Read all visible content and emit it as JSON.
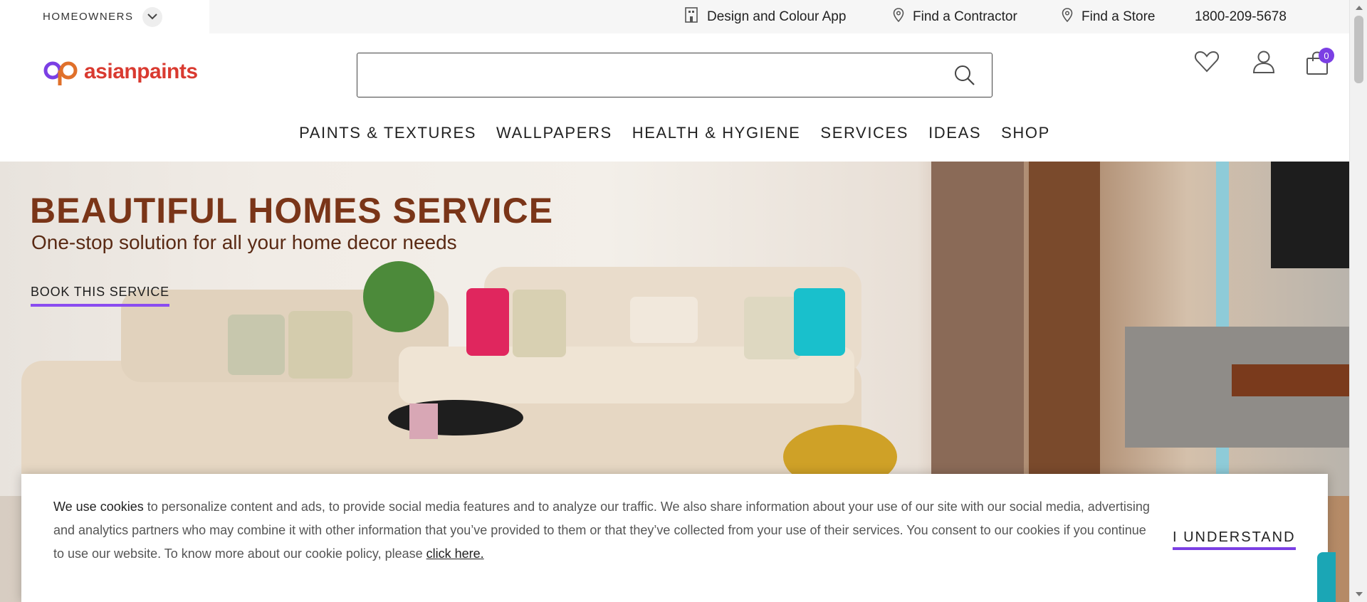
{
  "topbar": {
    "segment": "HOMEOWNERS",
    "links": [
      {
        "label": "Design and Colour App",
        "icon": "building-icon"
      },
      {
        "label": "Find a Contractor",
        "icon": "map-pin-icon"
      },
      {
        "label": "Find a Store",
        "icon": "map-pin-icon"
      }
    ],
    "phone": "1800-209-5678"
  },
  "header": {
    "logo_text": "asianpaints",
    "search_placeholder": "",
    "cart_count": "0"
  },
  "nav": [
    "PAINTS & TEXTURES",
    "WALLPAPERS",
    "HEALTH & HYGIENE",
    "SERVICES",
    "IDEAS",
    "SHOP"
  ],
  "hero": {
    "title": "BEAUTIFUL HOMES SERVICE",
    "subtitle": "One-stop solution for all your home decor needs",
    "cta": "BOOK THIS SERVICE"
  },
  "cookie": {
    "lead": "We use cookies",
    "body": " to personalize content and ads, to provide social media features and to analyze our traffic. We also share information about your use of our site with our social media, advertising and analytics partners who may combine it with other information that you’ve provided to them or that they’ve collected from your use of their services. You consent to our cookies if you continue to use our website. To know more about our cookie policy, please ",
    "link": "click here.",
    "button": "I UNDERSTAND"
  },
  "colors": {
    "accent": "#7b3fe4",
    "brand_red": "#d93a30",
    "hero_title": "#7a3518"
  }
}
